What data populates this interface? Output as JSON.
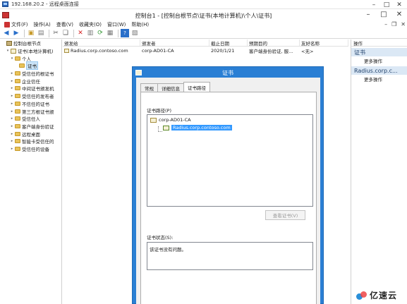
{
  "rdp": {
    "title": "192.168.20.2 - 远程桌面连接"
  },
  "mmc": {
    "caption": "控制台1 - [控制台根节点\\证书(本地计算机)\\个人\\证书]",
    "menu": [
      "文件(F)",
      "操作(A)",
      "查看(V)",
      "收藏夹(O)",
      "窗口(W)",
      "帮助(H)"
    ]
  },
  "tree": {
    "items": [
      {
        "label": "控制台根节点",
        "indent": 0,
        "expander": "",
        "icon": "root"
      },
      {
        "label": "证书(本地计算机)",
        "indent": 1,
        "expander": "▾",
        "icon": "cert"
      },
      {
        "label": "个人",
        "indent": 2,
        "expander": "▾",
        "icon": "folder"
      },
      {
        "label": "证书",
        "indent": 3,
        "expander": "",
        "icon": "folder",
        "selected": true
      },
      {
        "label": "受信任的根证书",
        "indent": 2,
        "expander": "▸",
        "icon": "folder"
      },
      {
        "label": "企业信任",
        "indent": 2,
        "expander": "▸",
        "icon": "folder"
      },
      {
        "label": "中间证书颁发机",
        "indent": 2,
        "expander": "▸",
        "icon": "folder"
      },
      {
        "label": "受信任的发布者",
        "indent": 2,
        "expander": "▸",
        "icon": "folder"
      },
      {
        "label": "不信任的证书",
        "indent": 2,
        "expander": "▸",
        "icon": "folder"
      },
      {
        "label": "第三方根证书颁",
        "indent": 2,
        "expander": "▸",
        "icon": "folder"
      },
      {
        "label": "受信任人",
        "indent": 2,
        "expander": "▸",
        "icon": "folder"
      },
      {
        "label": "客户端身份验证",
        "indent": 2,
        "expander": "▸",
        "icon": "folder"
      },
      {
        "label": "远程桌面",
        "indent": 2,
        "expander": "▸",
        "icon": "folder"
      },
      {
        "label": "智能卡受信任的",
        "indent": 2,
        "expander": "▸",
        "icon": "folder"
      },
      {
        "label": "受信任的设备",
        "indent": 2,
        "expander": "▸",
        "icon": "folder"
      }
    ]
  },
  "list": {
    "columns": [
      "颁发给",
      "颁发者",
      "截止日期",
      "预期目的",
      "友好名称"
    ],
    "rows": [
      [
        "Radius.corp.contoso.com",
        "corp-AD01-CA",
        "2020/1/21",
        "客户端身份验证, 服...",
        "<无>"
      ]
    ]
  },
  "actions": {
    "header": "操作",
    "groups": [
      {
        "title": "证书",
        "link": "更多操作"
      },
      {
        "title": "Radius.corp.c...",
        "link": "更多操作"
      }
    ]
  },
  "dialog": {
    "title": "证书",
    "tabs": [
      "常规",
      "详细信息",
      "证书路径"
    ],
    "path_label": "证书路径(P)",
    "root_node": "corp-AD01-CA",
    "leaf_node": "Radius.corp.contoso.com",
    "view_button": "查看证书(V)",
    "status_label": "证书状态(S):",
    "status_text": "该证书没有问题。"
  },
  "watermark": {
    "text": "亿速云"
  }
}
